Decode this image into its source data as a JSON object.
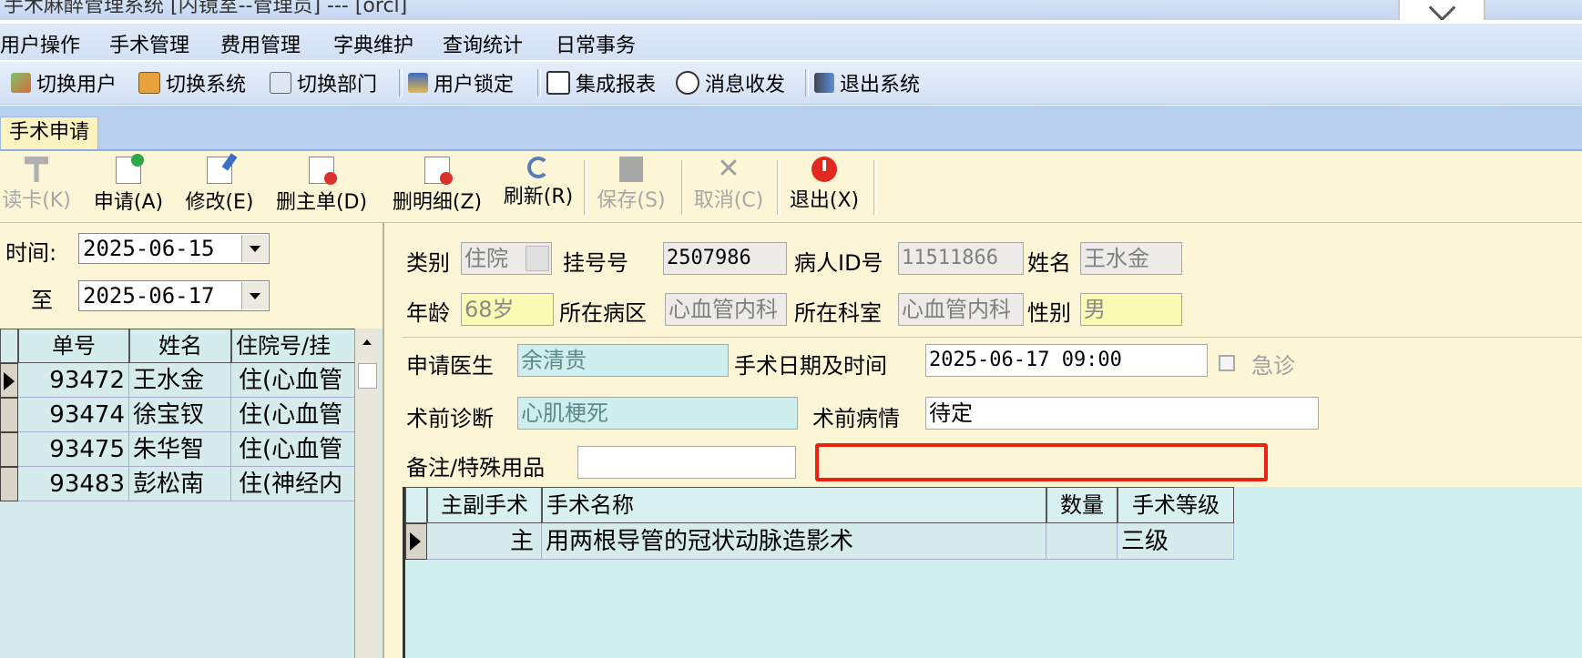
{
  "window": {
    "title": "手术麻醉管理系统 [内镜室--管理员] --- [orcl]"
  },
  "menu": [
    "用户操作",
    "手术管理",
    "费用管理",
    "字典维护",
    "查询统计",
    "日常事务"
  ],
  "quick_toolbar": [
    {
      "label": "切换用户",
      "icon": "switch-user-icon"
    },
    {
      "label": "切换系统",
      "icon": "switch-system-icon"
    },
    {
      "label": "切换部门",
      "icon": "switch-department-icon"
    },
    {
      "label": "用户锁定",
      "icon": "user-lock-icon"
    },
    {
      "label": "集成报表",
      "icon": "report-icon"
    },
    {
      "label": "消息收发",
      "icon": "message-icon"
    },
    {
      "label": "退出系统",
      "icon": "exit-system-icon"
    }
  ],
  "tab": {
    "label": "手术申请"
  },
  "main_toolbar": [
    {
      "label": "读卡(K)",
      "enabled": false,
      "icon": "read-card-icon"
    },
    {
      "label": "申请(A)",
      "enabled": true,
      "icon": "apply-icon"
    },
    {
      "label": "修改(E)",
      "enabled": true,
      "icon": "edit-icon"
    },
    {
      "label": "删主单(D)",
      "enabled": true,
      "icon": "delete-main-icon"
    },
    {
      "label": "删明细(Z)",
      "enabled": true,
      "icon": "delete-detail-icon"
    },
    {
      "label": "刷新(R)",
      "enabled": true,
      "icon": "refresh-icon"
    },
    {
      "label": "保存(S)",
      "enabled": false,
      "icon": "save-icon"
    },
    {
      "label": "取消(C)",
      "enabled": false,
      "icon": "cancel-icon"
    },
    {
      "label": "退出(X)",
      "enabled": true,
      "icon": "power-icon"
    }
  ],
  "filter": {
    "from_label": "时间:",
    "from": "2025-06-15",
    "to_label": "至",
    "to": "2025-06-17"
  },
  "list": {
    "columns": [
      "单号",
      "姓名",
      "住院号/挂"
    ],
    "rows": [
      {
        "id": "93472",
        "name": "王水金",
        "info": "住(心血管"
      },
      {
        "id": "93474",
        "name": "徐宝钗",
        "info": "住(心血管"
      },
      {
        "id": "93475",
        "name": "朱华智",
        "info": "住(心血管"
      },
      {
        "id": "93483",
        "name": "彭松南",
        "info": "住(神经内"
      }
    ]
  },
  "form": {
    "category_label": "类别",
    "category": "住院",
    "reg_label": "挂号号",
    "reg": "2507986",
    "pid_label": "病人ID号",
    "pid": "11511866",
    "name_label": "姓名",
    "name": "王水金",
    "age_label": "年龄",
    "age": "68岁",
    "ward_label": "所在病区",
    "ward": "心血管内科",
    "dept_label": "所在科室",
    "dept": "心血管内科",
    "sex_label": "性别",
    "sex": "男",
    "doctor_label": "申请医生",
    "doctor": "余清贵",
    "datetime_label": "手术日期及时间",
    "datetime": "2025-06-17 09:00",
    "emergency_label": "急诊",
    "diag_label": "术前诊断",
    "diag": "心肌梗死",
    "cond_label": "术前病情",
    "cond": "待定",
    "note_label": "备注/特殊用品",
    "note": ""
  },
  "surgery_table": {
    "columns": [
      "主副手术",
      "手术名称",
      "数量",
      "手术等级"
    ],
    "rows": [
      {
        "type": "主",
        "name": "用两根导管的冠状动脉造影术",
        "qty": "",
        "level": "三级"
      }
    ]
  },
  "colors": {
    "panel_bg": "#fcf6d6",
    "grid_bg": "#d0efef",
    "highlight": "#ee2211",
    "field_yellow": "#f9fbb3"
  }
}
